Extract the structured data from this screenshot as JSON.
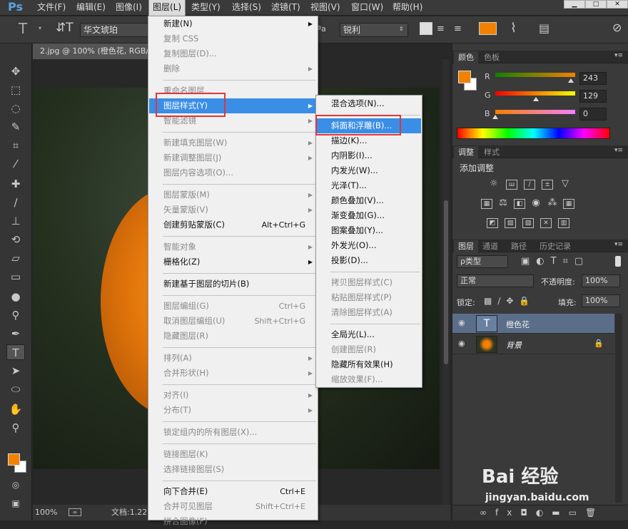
{
  "app": {
    "logo": "Ps"
  },
  "menubar": {
    "items": [
      "文件(F)",
      "编辑(E)",
      "图像(I)",
      "图层(L)",
      "类型(Y)",
      "选择(S)",
      "滤镜(T)",
      "视图(V)",
      "窗口(W)",
      "帮助(H)"
    ],
    "open": "图层(L)"
  },
  "options": {
    "font_family": "华文琥珀",
    "antialias": "锐利",
    "aa_label": "ªa",
    "text_color": "#f38100"
  },
  "document": {
    "tab_title": "2.jpg @ 100% (橙色花, RGB/...",
    "zoom": "100%",
    "doc_info": "文档:1.22"
  },
  "colors": {
    "foreground": "#f38100",
    "background": "#ffffff",
    "accent_highlight": "#3a8ee6",
    "red_box": "#e0363b"
  },
  "color_panel": {
    "tabs": [
      "颜色",
      "色板"
    ],
    "r_label": "R",
    "g_label": "G",
    "b_label": "B",
    "r": "243",
    "g": "129",
    "b": "0"
  },
  "adjust_panel": {
    "tabs": [
      "调整",
      "样式"
    ],
    "title": "添加调整"
  },
  "layers_panel": {
    "tabs": [
      "图层",
      "通道",
      "路径",
      "历史记录"
    ],
    "filter": "ρ类型",
    "blend_mode": "正常",
    "opacity_label": "不透明度:",
    "opacity": "100%",
    "lock_label": "锁定:",
    "fill_label": "填充:",
    "fill": "100%",
    "layers": [
      {
        "name": "橙色花",
        "type": "text",
        "selected": true
      },
      {
        "name": "背景",
        "type": "image",
        "locked": true
      }
    ]
  },
  "layer_menu": [
    {
      "label": "新建(N)",
      "arrow": true
    },
    {
      "label": "复制 CSS",
      "disabled": true
    },
    {
      "label": "复制图层(D)...",
      "disabled": true
    },
    {
      "label": "删除",
      "arrow": true,
      "disabled": true
    },
    {
      "sep": true
    },
    {
      "label": "重命名图层...",
      "disabled": true
    },
    {
      "label": "图层样式(Y)",
      "arrow": true,
      "highlight": true
    },
    {
      "label": "智能滤镜",
      "arrow": true,
      "disabled": true
    },
    {
      "sep": true
    },
    {
      "label": "新建填充图层(W)",
      "arrow": true,
      "disabled": true
    },
    {
      "label": "新建调整图层(J)",
      "arrow": true,
      "disabled": true
    },
    {
      "label": "图层内容选项(O)...",
      "disabled": true
    },
    {
      "sep": true
    },
    {
      "label": "图层蒙版(M)",
      "arrow": true,
      "disabled": true
    },
    {
      "label": "矢量蒙版(V)",
      "arrow": true,
      "disabled": true
    },
    {
      "label": "创建剪贴蒙版(C)",
      "shortcut": "Alt+Ctrl+G"
    },
    {
      "sep": true
    },
    {
      "label": "智能对象",
      "arrow": true,
      "disabled": true
    },
    {
      "label": "栅格化(Z)",
      "arrow": true
    },
    {
      "sep": true
    },
    {
      "label": "新建基于图层的切片(B)"
    },
    {
      "sep": true
    },
    {
      "label": "图层编组(G)",
      "shortcut": "Ctrl+G",
      "disabled": true
    },
    {
      "label": "取消图层编组(U)",
      "shortcut": "Shift+Ctrl+G",
      "disabled": true
    },
    {
      "label": "隐藏图层(R)",
      "disabled": true
    },
    {
      "sep": true
    },
    {
      "label": "排列(A)",
      "arrow": true,
      "disabled": true
    },
    {
      "label": "合并形状(H)",
      "arrow": true,
      "disabled": true
    },
    {
      "sep": true
    },
    {
      "label": "对齐(I)",
      "arrow": true,
      "disabled": true
    },
    {
      "label": "分布(T)",
      "arrow": true,
      "disabled": true
    },
    {
      "sep": true
    },
    {
      "label": "锁定组内的所有图层(X)...",
      "disabled": true
    },
    {
      "sep": true
    },
    {
      "label": "链接图层(K)",
      "disabled": true
    },
    {
      "label": "选择链接图层(S)",
      "disabled": true
    },
    {
      "sep": true
    },
    {
      "label": "向下合并(E)",
      "shortcut": "Ctrl+E"
    },
    {
      "label": "合并可见图层",
      "shortcut": "Shift+Ctrl+E",
      "disabled": true
    },
    {
      "label": "拼合图像(F)",
      "disabled": true
    }
  ],
  "style_menu": [
    {
      "label": "混合选项(N)..."
    },
    {
      "sep": true
    },
    {
      "label": "斜面和浮雕(B)...",
      "highlight": true
    },
    {
      "label": "描边(K)..."
    },
    {
      "label": "内阴影(I)..."
    },
    {
      "label": "内发光(W)..."
    },
    {
      "label": "光泽(T)..."
    },
    {
      "label": "颜色叠加(V)..."
    },
    {
      "label": "渐变叠加(G)..."
    },
    {
      "label": "图案叠加(Y)..."
    },
    {
      "label": "外发光(O)..."
    },
    {
      "label": "投影(D)..."
    },
    {
      "sep": true
    },
    {
      "label": "拷贝图层样式(C)",
      "disabled": true
    },
    {
      "label": "粘贴图层样式(P)",
      "disabled": true
    },
    {
      "label": "清除图层样式(A)",
      "disabled": true
    },
    {
      "sep": true
    },
    {
      "label": "全局光(L)..."
    },
    {
      "label": "创建图层(R)",
      "disabled": true
    },
    {
      "label": "隐藏所有效果(H)"
    },
    {
      "label": "缩放效果(F)...",
      "disabled": true
    }
  ],
  "watermark": {
    "top": "Bai 经验",
    "bottom": "jingyan.baidu.com"
  }
}
